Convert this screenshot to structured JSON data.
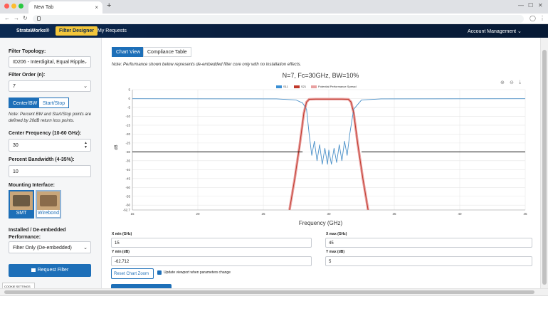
{
  "browser": {
    "tab_title": "New Tab",
    "tab_close": "×",
    "new_tab": "+",
    "minimize": "—",
    "maximize": "☐",
    "close": "✕"
  },
  "appnav": {
    "brand": "StrataWorks®",
    "filter_designer": "Filter Designer",
    "my_requests": "My Requests",
    "account": "Account Management ⌄"
  },
  "sidebar": {
    "topology_label": "Filter Topology:",
    "topology_value": "ID206 - Interdigital, Equal Ripple",
    "order_label": "Filter Order (n):",
    "order_value": "7",
    "toggle_center": "Center/BW",
    "toggle_startstop": "Start/Stop",
    "note": "Note: Percent BW and Start/Stop points are defined by 20dB return loss points.",
    "center_label": "Center Frequency (10-60 GHz):",
    "center_value": "30",
    "bw_label": "Percent Bandwidth (4-35%):",
    "bw_value": "10",
    "mounting_label": "Mounting Interface:",
    "smt": "SMT",
    "wirebond": "Wirebond",
    "perf_label": "Installed / De-embedded Performance:",
    "perf_value": "Filter Only (De-embedded)",
    "request_button": "Request Filter",
    "cookie": "COOKIE SETTINGS"
  },
  "main": {
    "tab_chart": "Chart View",
    "tab_compliance": "Compliance Table",
    "note": "Note: Performance shown below represents de-embedded filter core only with no installation effects.",
    "chart_title": "N=7, Fc=30GHz, BW=10%",
    "legend_s11": "S11",
    "legend_s21": "S21",
    "legend_spread": "Potential Performance Spread",
    "xmin_label": "X min (GHz)",
    "xmin_value": "15",
    "xmax_label": "X max (GHz)",
    "xmax_value": "45",
    "ymin_label": "Y min (dB)",
    "ymin_value": "-62.712",
    "ymax_label": "Y max (dB)",
    "ymax_value": "5",
    "reset_button": "Reset Chart Zoom",
    "update_viewport": "Update viewport when parameters change",
    "zoom_in": "⊕",
    "zoom_out": "⊖",
    "download": "⤓"
  },
  "chart_data": {
    "type": "line",
    "title": "N=7, Fc=30GHz, BW=10%",
    "xlabel": "Frequency (GHz)",
    "ylabel": "dB",
    "xlim": [
      15,
      45
    ],
    "ylim": [
      -62.712,
      5
    ],
    "xticks": [
      15,
      20,
      25,
      30,
      35,
      40,
      45
    ],
    "yticks": [
      5,
      0,
      -5,
      -10,
      -15,
      -20,
      -25,
      -30,
      -35,
      -40,
      -45,
      -50,
      -55,
      -60,
      -62.7
    ],
    "ytick_labels": [
      "5",
      "0",
      "-5",
      "-10",
      "-15",
      "-20",
      "-25",
      "-30",
      "-35",
      "-40",
      "-45",
      "-50",
      "-55",
      "-60",
      "-62.7"
    ],
    "xtick_labels": [
      "15",
      "20",
      "25",
      "30",
      "35",
      "40",
      "45"
    ],
    "colors": {
      "s11": "#4a90c8",
      "s21": "#c0392b",
      "spread": "#e8a0a0",
      "mask": "#111111"
    },
    "series": [
      {
        "name": "S11",
        "x": [
          15,
          26,
          27.5,
          28,
          28.3,
          28.5,
          28.7,
          28.9,
          29.1,
          29.3,
          29.5,
          29.7,
          29.9,
          30,
          30.2,
          30.4,
          30.6,
          30.8,
          31,
          31.2,
          31.4,
          31.6,
          31.9,
          32.5,
          34,
          45
        ],
        "y": [
          -0.1,
          -0.2,
          -0.8,
          -2.5,
          -6,
          -20,
          -32,
          -24,
          -35,
          -26,
          -37,
          -28,
          -37,
          -29,
          -37,
          -28,
          -36,
          -26,
          -35,
          -24,
          -32,
          -20,
          -6,
          -0.8,
          -0.2,
          -0.1
        ]
      },
      {
        "name": "S21",
        "x": [
          27.0,
          27.4,
          27.8,
          28.1,
          28.3,
          28.5,
          29,
          30,
          31,
          31.5,
          31.7,
          31.9,
          32.2,
          32.6,
          33
        ],
        "y": [
          -62.7,
          -45,
          -25,
          -8,
          -2,
          -0.4,
          -0.3,
          -0.3,
          -0.3,
          -0.4,
          -2,
          -8,
          -25,
          -45,
          -62.7
        ]
      },
      {
        "name": "Limit Mask Low",
        "x": [
          15,
          28
        ],
        "y": [
          -30,
          -30
        ]
      },
      {
        "name": "Limit Mask High",
        "x": [
          32.5,
          45
        ],
        "y": [
          -30,
          -30
        ]
      }
    ]
  }
}
